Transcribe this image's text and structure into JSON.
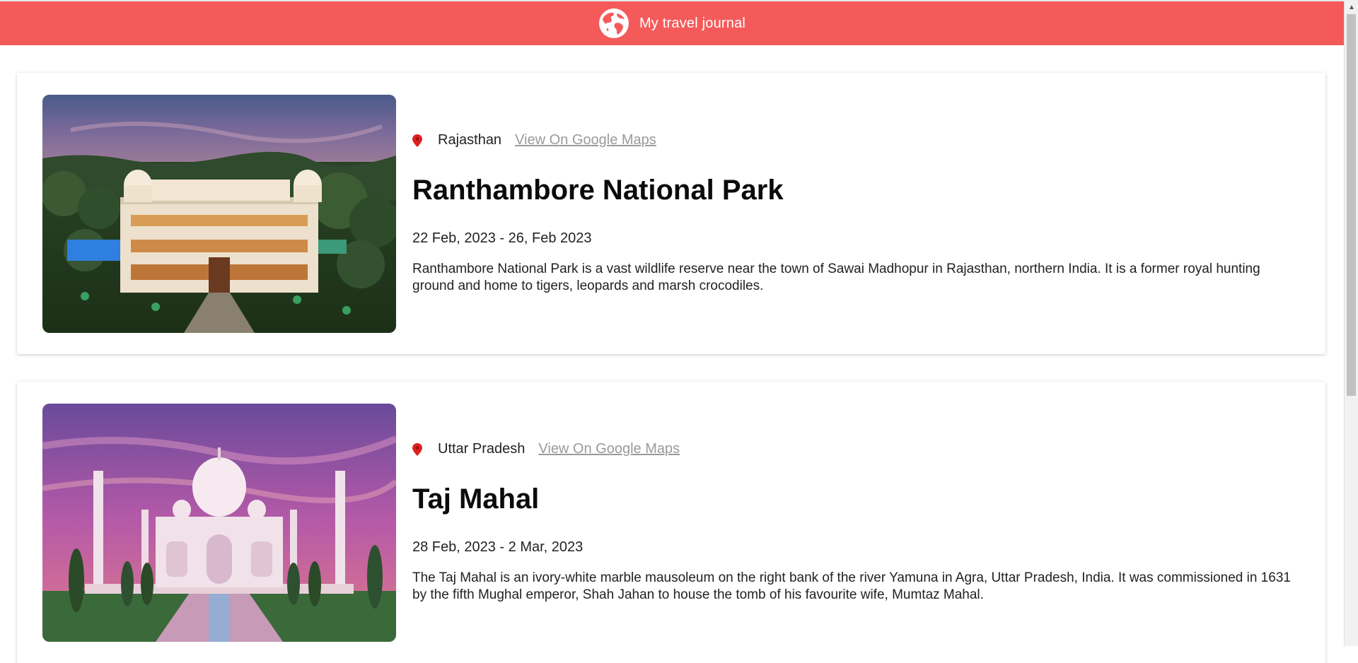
{
  "header": {
    "title": "My travel journal",
    "icon": "globe-icon",
    "color": "#f55a5a"
  },
  "entries": [
    {
      "image_alt": "Ranthambore National Park",
      "location": "Rajasthan",
      "maps_label": "View On Google Maps",
      "title": "Ranthambore National Park",
      "dates": "22 Feb, 2023 - 26, Feb 2023",
      "description": "Ranthambore National Park is a vast wildlife reserve near the town of Sawai Madhopur in Rajasthan, northern India. It is a former royal hunting ground and home to tigers, leopards and marsh crocodiles."
    },
    {
      "image_alt": "Taj Mahal",
      "location": "Uttar Pradesh",
      "maps_label": "View On Google Maps",
      "title": "Taj Mahal",
      "dates": "28 Feb, 2023 - 2 Mar, 2023",
      "description": "The Taj Mahal is an ivory-white marble mausoleum on the right bank of the river Yamuna in Agra, Uttar Pradesh, India. It was commissioned in 1631 by the fifth Mughal emperor, Shah Jahan to house the tomb of his favourite wife, Mumtaz Mahal."
    }
  ]
}
